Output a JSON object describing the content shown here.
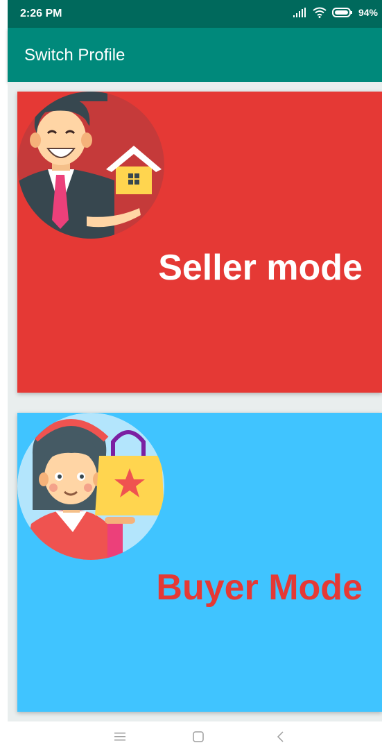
{
  "status_bar": {
    "time": "2:26 PM",
    "battery": "94%",
    "icons": [
      "signal-icon",
      "wifi-icon",
      "battery-icon"
    ]
  },
  "app_bar": {
    "title": "Switch Profile",
    "color": "#00897b"
  },
  "cards": [
    {
      "label": "Seller mode",
      "background": "#e53935",
      "label_color": "#ffffff",
      "icon": "seller-avatar-icon"
    },
    {
      "label": "Buyer Mode",
      "background": "#40c4ff",
      "label_color": "#e53935",
      "icon": "buyer-avatar-icon"
    }
  ],
  "nav_bar": {
    "icons": [
      "menu-icon",
      "home-icon",
      "back-icon"
    ]
  }
}
